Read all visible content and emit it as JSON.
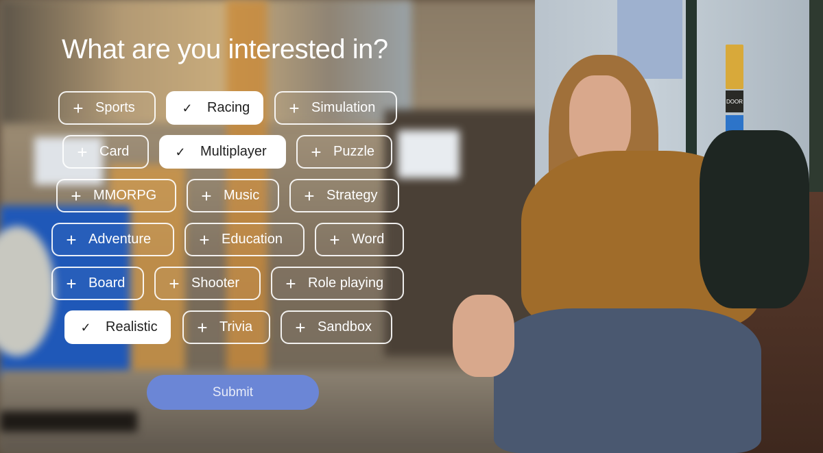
{
  "title": "What are you interested in?",
  "icons": {
    "add": "+",
    "check": "✓"
  },
  "chips": [
    {
      "label": "Sports",
      "selected": false
    },
    {
      "label": "Racing",
      "selected": true
    },
    {
      "label": "Simulation",
      "selected": false
    },
    {
      "label": "Card",
      "selected": false
    },
    {
      "label": "Multiplayer",
      "selected": true
    },
    {
      "label": "Puzzle",
      "selected": false
    },
    {
      "label": "MMORPG",
      "selected": false
    },
    {
      "label": "Music",
      "selected": false
    },
    {
      "label": "Strategy",
      "selected": false
    },
    {
      "label": "Adventure",
      "selected": false
    },
    {
      "label": "Education",
      "selected": false
    },
    {
      "label": "Word",
      "selected": false
    },
    {
      "label": "Board",
      "selected": false
    },
    {
      "label": "Shooter",
      "selected": false
    },
    {
      "label": "Role playing",
      "selected": false
    },
    {
      "label": "Realistic",
      "selected": true
    },
    {
      "label": "Trivia",
      "selected": false
    },
    {
      "label": "Sandbox",
      "selected": false
    }
  ],
  "submit_label": "Submit",
  "colors": {
    "submit": "#6b86d6",
    "selected_chip": "#ffffff"
  },
  "background": {
    "sign_text": "DOOR"
  }
}
